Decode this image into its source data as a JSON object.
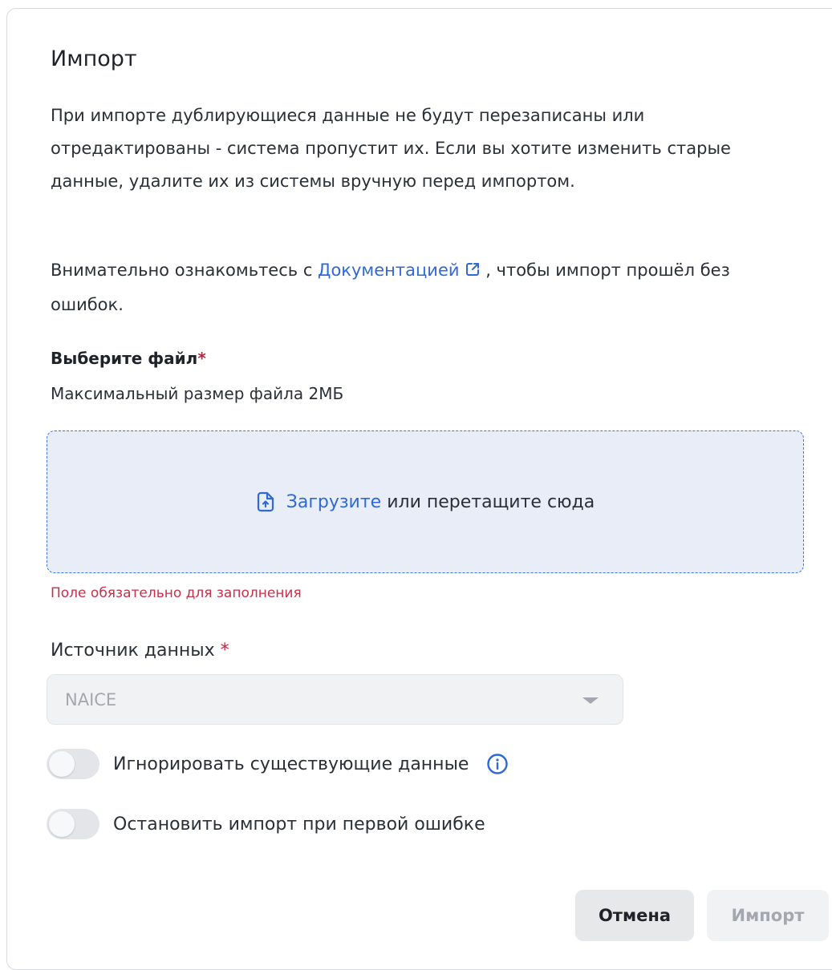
{
  "dialog": {
    "title": "Импорт",
    "intro_text": "При импорте дублирующиеся данные не будут перезаписаны или отредактированы - система пропустит их. Если вы хотите изменить старые данные, удалите их из системы вручную перед импортом.",
    "docs_prefix": "Внимательно ознакомьтесь с ",
    "docs_link": "Документацией",
    "docs_suffix": " , чтобы импорт прошёл без ошибок."
  },
  "file_field": {
    "label": "Выберите файл",
    "required_mark": "*",
    "hint": "Максимальный размер файла 2МБ",
    "dropzone_link": "Загрузите",
    "dropzone_text": " или перетащите сюда",
    "error": "Поле обязательно для заполнения"
  },
  "source_field": {
    "label": "Источник данных ",
    "required_mark": "*",
    "selected": "NAICE"
  },
  "toggles": [
    {
      "label": "Игнорировать существующие данные",
      "on": false
    },
    {
      "label": "Остановить импорт при первой ошибке",
      "on": false
    }
  ],
  "buttons": {
    "cancel": "Отмена",
    "import": "Импорт"
  },
  "colors": {
    "accent": "#2e69d6",
    "error": "#c8304a",
    "dropzone_bg": "#e9edf8"
  }
}
